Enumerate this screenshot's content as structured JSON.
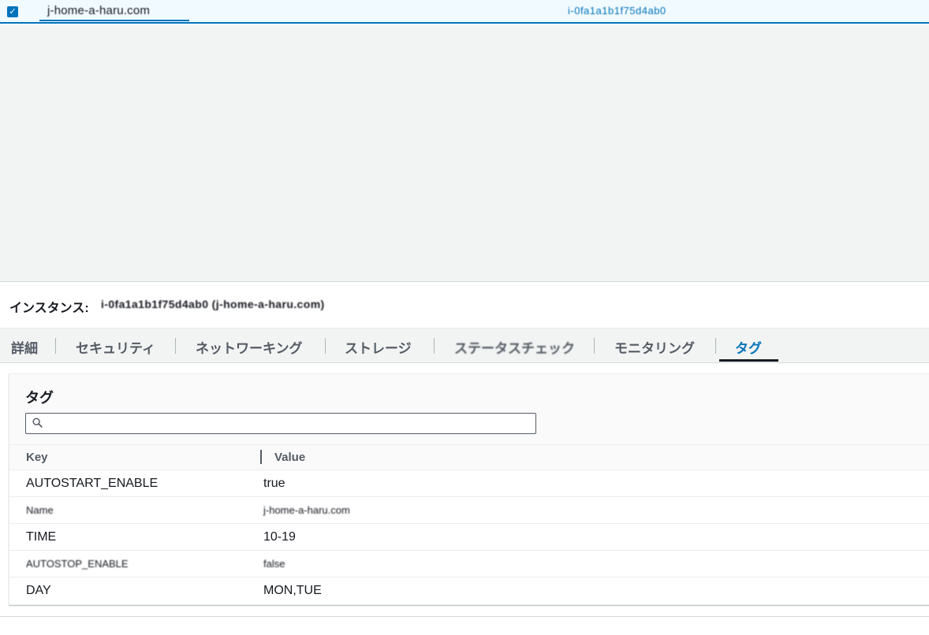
{
  "top_row": {
    "instance_name": "j-home-a-haru.com",
    "ip": "i-0fa1a1b1f75d4ab0"
  },
  "instance": {
    "label": "インスタンス:",
    "id": "i-0fa1a1b1f75d4ab0 (j-home-a-haru.com)"
  },
  "tabs": [
    {
      "label": "詳細"
    },
    {
      "label": "セキュリティ"
    },
    {
      "label": "ネットワーキング"
    },
    {
      "label": "ストレージ"
    },
    {
      "label": "ステータスチェック"
    },
    {
      "label": "モニタリング"
    },
    {
      "label": "タグ",
      "active": true
    }
  ],
  "tags_panel": {
    "title": "タグ",
    "search_placeholder": "",
    "columns": {
      "key": "Key",
      "value": "Value"
    },
    "rows": [
      {
        "key": "AUTOSTART_ENABLE",
        "value": "true"
      },
      {
        "key": "Name",
        "value": "j-home-a-haru.com"
      },
      {
        "key": "TIME",
        "value": "10-19"
      },
      {
        "key": "AUTOSTOP_ENABLE",
        "value": "false"
      },
      {
        "key": "DAY",
        "value": "MON,TUE"
      }
    ]
  },
  "colors": {
    "accent": "#0073bb",
    "text": "#16191f",
    "muted": "#545b64"
  }
}
